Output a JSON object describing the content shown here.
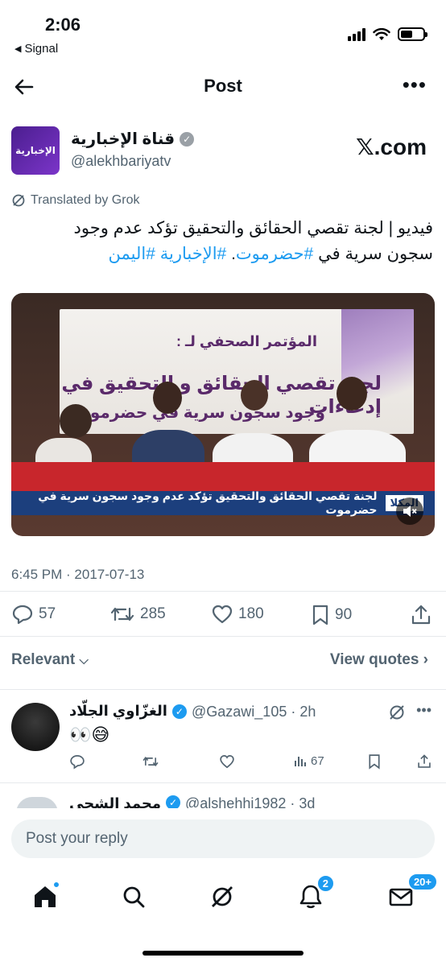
{
  "status": {
    "time": "2:06",
    "back_label": "Signal"
  },
  "header": {
    "title": "Post"
  },
  "post": {
    "avatar_text": "الإخبارية",
    "account_name": "قناة الإخبارية",
    "handle": "@alekhbariyatv",
    "source_label": "𝕏.com",
    "translated_label": "Translated by Grok",
    "text_line1": "فيديو | لجنة تقصي الحقائق والتحقيق تؤكد عدم وجود",
    "text_line2_plain": "سجون سرية في ",
    "text_line2_tag1": "#حضرموت",
    "text_line2_sep": ". ",
    "text_line2_tag2": "#الإخبارية",
    "text_line2_tag3": "#اليمن",
    "timestamp": "6:45 PM · 2017-07-13"
  },
  "media": {
    "banner_line1": "المؤتمر الصحفي لـ :",
    "banner_line2": "لجنة تقصي الحقائق و التحقيق في إدعاءات",
    "banner_line3": "وجود سجون سرية في حضرموت",
    "caption_text": "لجنة تقصي الحقائق والتحقيق تؤكد عدم وجود سجون سرية في حضرموت",
    "caption_location": "المكلا"
  },
  "actions": {
    "replies": "57",
    "reposts": "285",
    "likes": "180",
    "bookmarks": "90"
  },
  "sort": {
    "relevant_label": "Relevant",
    "view_quotes_label": "View quotes"
  },
  "reply1": {
    "name": "الغزّاوي الجلّاد",
    "handle": "@Gazawi_105 · 2h",
    "text": "👀😅",
    "views": "67"
  },
  "reply2": {
    "name": "محمد الشحي",
    "handle": "@alshehhi1982 · 3d"
  },
  "composer": {
    "placeholder": "Post your reply"
  },
  "tabbar": {
    "notifications_badge": "2",
    "messages_badge": "20+"
  },
  "colors": {
    "accent": "#1d9bf0",
    "text": "#0f1419",
    "muted": "#536471"
  }
}
